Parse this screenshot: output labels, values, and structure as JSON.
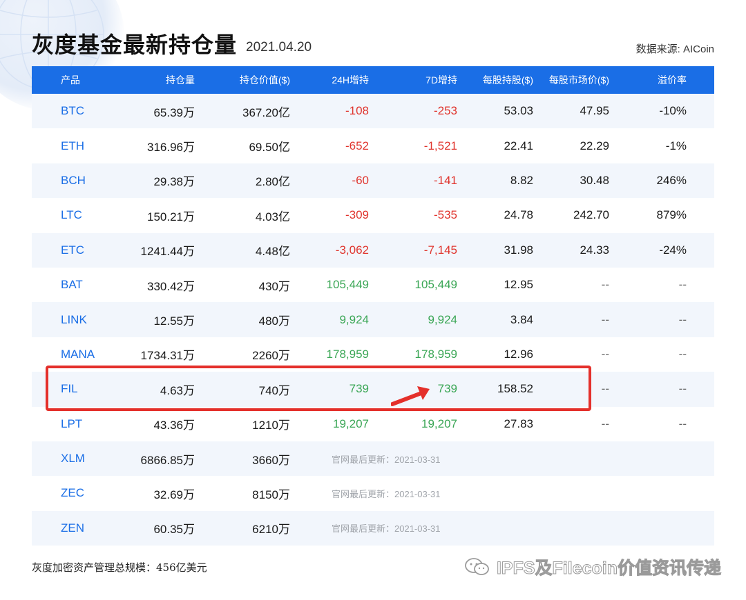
{
  "header": {
    "title": "灰度基金最新持仓量",
    "date": "2021.04.20",
    "source": "数据来源: AICoin"
  },
  "table": {
    "columns": [
      "产品",
      "持仓量",
      "持仓价值($)",
      "24H增持",
      "7D增持",
      "每股持股($)",
      "每股市场价($)",
      "溢价率"
    ],
    "rows": [
      {
        "coin": "BTC",
        "holdings": "65.39万",
        "value": "367.20亿",
        "h24": "-108",
        "d7": "-253",
        "per_share": "53.03",
        "market_price": "47.95",
        "premium": "-10%"
      },
      {
        "coin": "ETH",
        "holdings": "316.96万",
        "value": "69.50亿",
        "h24": "-652",
        "d7": "-1,521",
        "per_share": "22.41",
        "market_price": "22.29",
        "premium": "-1%"
      },
      {
        "coin": "BCH",
        "holdings": "29.38万",
        "value": "2.80亿",
        "h24": "-60",
        "d7": "-141",
        "per_share": "8.82",
        "market_price": "30.48",
        "premium": "246%"
      },
      {
        "coin": "LTC",
        "holdings": "150.21万",
        "value": "4.03亿",
        "h24": "-309",
        "d7": "-535",
        "per_share": "24.78",
        "market_price": "242.70",
        "premium": "879%"
      },
      {
        "coin": "ETC",
        "holdings": "1241.44万",
        "value": "4.48亿",
        "h24": "-3,062",
        "d7": "-7,145",
        "per_share": "31.98",
        "market_price": "24.33",
        "premium": "-24%"
      },
      {
        "coin": "BAT",
        "holdings": "330.42万",
        "value": "430万",
        "h24": "105,449",
        "d7": "105,449",
        "per_share": "12.95",
        "market_price": "--",
        "premium": "--"
      },
      {
        "coin": "LINK",
        "holdings": "12.55万",
        "value": "480万",
        "h24": "9,924",
        "d7": "9,924",
        "per_share": "3.84",
        "market_price": "--",
        "premium": "--"
      },
      {
        "coin": "MANA",
        "holdings": "1734.31万",
        "value": "2260万",
        "h24": "178,959",
        "d7": "178,959",
        "per_share": "12.96",
        "market_price": "--",
        "premium": "--"
      },
      {
        "coin": "FIL",
        "holdings": "4.63万",
        "value": "740万",
        "h24": "739",
        "d7": "739",
        "per_share": "158.52",
        "market_price": "--",
        "premium": "--"
      },
      {
        "coin": "LPT",
        "holdings": "43.36万",
        "value": "1210万",
        "h24": "19,207",
        "d7": "19,207",
        "per_share": "27.83",
        "market_price": "--",
        "premium": "--"
      },
      {
        "coin": "XLM",
        "holdings": "6866.85万",
        "value": "3660万",
        "note": "官网最后更新：2021-03-31"
      },
      {
        "coin": "ZEC",
        "holdings": "32.69万",
        "value": "8150万",
        "note": "官网最后更新：2021-03-31"
      },
      {
        "coin": "ZEN",
        "holdings": "60.35万",
        "value": "6210万",
        "note": "官网最后更新：2021-03-31"
      }
    ]
  },
  "footer": {
    "total": "灰度加密资产管理总规模：456亿美元",
    "watermark": "IPFS及Filecoin价值资讯传递"
  },
  "colors": {
    "header_bg": "#1a6ee6",
    "coin": "#1a6ee6",
    "negative": "#e0342d",
    "positive": "#3aa655",
    "highlight": "#e4302b",
    "row_alt": "#f2f6fc"
  },
  "icons": [
    "globe-icon",
    "arrow-icon",
    "wechat-icon"
  ]
}
